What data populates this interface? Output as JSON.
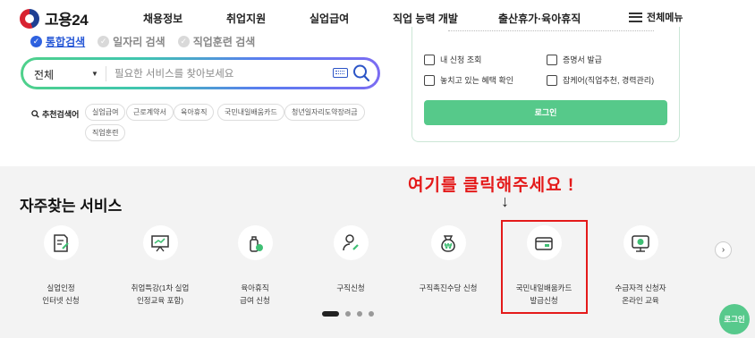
{
  "header": {
    "logo_text": "고용24",
    "nav": [
      "채용정보",
      "취업지원",
      "실업급여",
      "직업 능력 개발",
      "출산휴가·육아휴직"
    ],
    "menu_all": "전체메뉴"
  },
  "search": {
    "tabs": [
      "통합검색",
      "일자리 검색",
      "직업훈련 검색"
    ],
    "select_value": "전체",
    "placeholder": "필요한 서비스를 찾아보세요",
    "recommend_label": "추천검색어",
    "keywords": [
      "실업급여",
      "근로계약서",
      "육아휴직",
      "국민내일배움카드",
      "청년일자리도약장려금",
      "직업훈련"
    ]
  },
  "panel": {
    "items": [
      "내 신청 조회",
      "증명서 발급",
      "놓치고 있는 혜택 확인",
      "잡케어(직업추천, 경력관리)"
    ],
    "login_button": "로그인"
  },
  "services": {
    "title": "자주찾는 서비스",
    "callout": "여기를 클릭해주세요 !",
    "callout_arrow": "↓",
    "items": [
      {
        "line1": "실업인정",
        "line2": "인터넷 신청",
        "icon": "document-check-icon"
      },
      {
        "line1": "취업특강(1차 실업",
        "line2": "인정교육 포함)",
        "icon": "lecture-board-icon"
      },
      {
        "line1": "육아휴직",
        "line2": "급여 신청",
        "icon": "baby-bottle-icon"
      },
      {
        "line1": "구직신청",
        "line2": "",
        "icon": "person-search-icon"
      },
      {
        "line1": "구직촉진수당 신청",
        "line2": "",
        "icon": "money-bag-icon"
      },
      {
        "line1": "국민내일배움카드",
        "line2": "발급신청",
        "icon": "card-icon"
      },
      {
        "line1": "수급자격 신청자",
        "line2": "온라인 교육",
        "icon": "online-education-icon"
      }
    ],
    "next_label": "›",
    "float_login": "로그인"
  },
  "colors": {
    "accent_green": "#56c98a",
    "brand_blue": "#2456d6",
    "alert_red": "#e41a1a"
  }
}
